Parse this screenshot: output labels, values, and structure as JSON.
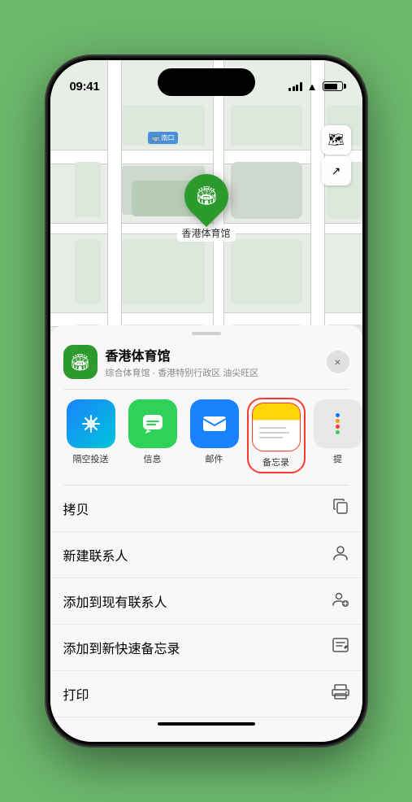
{
  "status": {
    "time": "09:41",
    "location_arrow": "▶"
  },
  "map": {
    "label_text": "南口",
    "pin_label": "香港体育馆"
  },
  "location_card": {
    "name": "香港体育馆",
    "description": "综合体育馆 · 香港特别行政区 油尖旺区",
    "close_label": "×"
  },
  "share_items": [
    {
      "id": "airdrop",
      "label": "隔空投送",
      "icon": "📶"
    },
    {
      "id": "messages",
      "label": "信息",
      "icon": "💬"
    },
    {
      "id": "mail",
      "label": "邮件",
      "icon": "✉️"
    },
    {
      "id": "notes",
      "label": "备忘录",
      "icon": ""
    },
    {
      "id": "more",
      "label": "提",
      "icon": "⋯"
    }
  ],
  "actions": [
    {
      "label": "拷贝",
      "icon": "copy"
    },
    {
      "label": "新建联系人",
      "icon": "person"
    },
    {
      "label": "添加到现有联系人",
      "icon": "person-add"
    },
    {
      "label": "添加到新快速备忘录",
      "icon": "note"
    },
    {
      "label": "打印",
      "icon": "printer"
    }
  ]
}
